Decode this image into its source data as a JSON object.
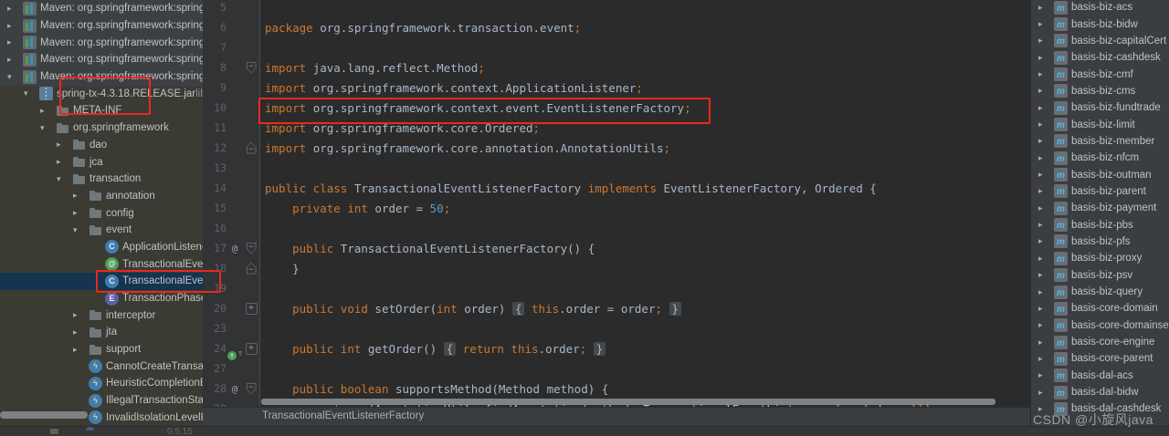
{
  "window": {
    "watermark": "CSDN @小旋风java"
  },
  "colors": {
    "annotation_red": "#E8291D",
    "tree_selection_blue": "#15344E",
    "keyword_orange": "#CC7832",
    "number_blue": "#6897BB",
    "editor_bg": "#2B2B2B",
    "panel_bg": "#3D4042",
    "panel_lower_bg": "#3B3A33"
  },
  "left_tree": {
    "rows": [
      {
        "d": 0,
        "a": ">",
        "icon": "lib",
        "label": "Maven: org.springframework:spring-"
      },
      {
        "d": 0,
        "a": ">",
        "icon": "lib",
        "label": "Maven: org.springframework:spring-"
      },
      {
        "d": 0,
        "a": ">",
        "icon": "lib",
        "label": "Maven: org.springframework:spring-"
      },
      {
        "d": 0,
        "a": ">",
        "icon": "lib",
        "label": "Maven: org.springframework:spring-"
      },
      {
        "d": 0,
        "a": "v",
        "icon": "lib",
        "label": "Maven: org.springframework:spring-"
      },
      {
        "d": 1,
        "a": "v",
        "icon": "jar",
        "label": "spring-tx-4.3.18.RELEASE.jar",
        "suffix": "library"
      },
      {
        "d": 2,
        "a": ">",
        "icon": "folder",
        "label": "META-INF"
      },
      {
        "d": 2,
        "a": "v",
        "icon": "folder",
        "label": "org.springframework"
      },
      {
        "d": 3,
        "a": ">",
        "icon": "folder",
        "label": "dao"
      },
      {
        "d": 3,
        "a": ">",
        "icon": "folder",
        "label": "jca"
      },
      {
        "d": 3,
        "a": "v",
        "icon": "folder",
        "label": "transaction"
      },
      {
        "d": 4,
        "a": ">",
        "icon": "folder",
        "label": "annotation"
      },
      {
        "d": 4,
        "a": ">",
        "icon": "folder",
        "label": "config"
      },
      {
        "d": 4,
        "a": "v",
        "icon": "folder",
        "label": "event"
      },
      {
        "d": 5,
        "a": "",
        "icon": "cls",
        "label": "ApplicationListenerMethodTransactionalAdapter"
      },
      {
        "d": 5,
        "a": "",
        "icon": "ann",
        "label": "TransactionalEventListener"
      },
      {
        "d": 5,
        "a": "",
        "icon": "cls",
        "label": "TransactionalEventListenerFactory",
        "sel": true
      },
      {
        "d": 5,
        "a": "",
        "icon": "enm",
        "label": "TransactionPhase"
      },
      {
        "d": 4,
        "a": ">",
        "icon": "folder",
        "label": "interceptor"
      },
      {
        "d": 4,
        "a": ">",
        "icon": "folder",
        "label": "jta"
      },
      {
        "d": 4,
        "a": ">",
        "icon": "folder",
        "label": "support"
      },
      {
        "d": 4,
        "a": "",
        "icon": "exc",
        "label": "CannotCreateTransactionException"
      },
      {
        "d": 4,
        "a": "",
        "icon": "exc",
        "label": "HeuristicCompletionException"
      },
      {
        "d": 4,
        "a": "",
        "icon": "exc",
        "label": "IllegalTransactionStateException"
      },
      {
        "d": 4,
        "a": "",
        "icon": "exc",
        "label": "InvalidIsolationLevelException"
      }
    ]
  },
  "right_tree": {
    "rows": [
      {
        "d": 0,
        "a": ">",
        "icon": "mod",
        "label": "basis-biz-acs"
      },
      {
        "d": 0,
        "a": ">",
        "icon": "mod",
        "label": "basis-biz-bidw"
      },
      {
        "d": 0,
        "a": ">",
        "icon": "mod",
        "label": "basis-biz-capitalCert"
      },
      {
        "d": 0,
        "a": ">",
        "icon": "mod",
        "label": "basis-biz-cashdesk"
      },
      {
        "d": 0,
        "a": ">",
        "icon": "mod",
        "label": "basis-biz-cmf"
      },
      {
        "d": 0,
        "a": ">",
        "icon": "mod",
        "label": "basis-biz-cms"
      },
      {
        "d": 0,
        "a": ">",
        "icon": "mod",
        "label": "basis-biz-fundtrade"
      },
      {
        "d": 0,
        "a": ">",
        "icon": "mod",
        "label": "basis-biz-limit"
      },
      {
        "d": 0,
        "a": ">",
        "icon": "mod",
        "label": "basis-biz-member"
      },
      {
        "d": 0,
        "a": ">",
        "icon": "mod",
        "label": "basis-biz-nfcm"
      },
      {
        "d": 0,
        "a": ">",
        "icon": "mod",
        "label": "basis-biz-outman"
      },
      {
        "d": 0,
        "a": ">",
        "icon": "mod",
        "label": "basis-biz-parent"
      },
      {
        "d": 0,
        "a": ">",
        "icon": "mod",
        "label": "basis-biz-payment"
      },
      {
        "d": 0,
        "a": ">",
        "icon": "mod",
        "label": "basis-biz-pbs"
      },
      {
        "d": 0,
        "a": ">",
        "icon": "mod",
        "label": "basis-biz-pfs"
      },
      {
        "d": 0,
        "a": ">",
        "icon": "mod",
        "label": "basis-biz-proxy"
      },
      {
        "d": 0,
        "a": ">",
        "icon": "mod",
        "label": "basis-biz-psv"
      },
      {
        "d": 0,
        "a": ">",
        "icon": "mod",
        "label": "basis-biz-query"
      },
      {
        "d": 0,
        "a": ">",
        "icon": "mod",
        "label": "basis-core-domain"
      },
      {
        "d": 0,
        "a": ">",
        "icon": "mod",
        "label": "basis-core-domainservice"
      },
      {
        "d": 0,
        "a": ">",
        "icon": "mod",
        "label": "basis-core-engine"
      },
      {
        "d": 0,
        "a": ">",
        "icon": "mod",
        "label": "basis-core-parent"
      },
      {
        "d": 0,
        "a": ">",
        "icon": "mod",
        "label": "basis-dal-acs"
      },
      {
        "d": 0,
        "a": ">",
        "icon": "mod",
        "label": "basis-dal-bidw"
      },
      {
        "d": 0,
        "a": ">",
        "icon": "mod",
        "label": "basis-dal-cashdesk"
      }
    ]
  },
  "editor": {
    "breadcrumb": "TransactionalEventListenerFactory",
    "lines": [
      {
        "num": "5",
        "mark": "",
        "fold": "",
        "segments": []
      },
      {
        "num": "6",
        "mark": "",
        "fold": "",
        "segments": [
          [
            "k",
            "package "
          ],
          [
            "p",
            "org.springframework.transaction.event"
          ],
          [
            "k",
            ";"
          ]
        ]
      },
      {
        "num": "7",
        "mark": "",
        "fold": "",
        "segments": []
      },
      {
        "num": "8",
        "mark": "",
        "fold": "down",
        "segments": [
          [
            "k",
            "import "
          ],
          [
            "p",
            "java.lang.reflect.Method"
          ],
          [
            "k",
            ";"
          ]
        ]
      },
      {
        "num": "9",
        "mark": "",
        "fold": "",
        "segments": [
          [
            "k",
            "import "
          ],
          [
            "p",
            "org.springframework.context.ApplicationListener"
          ],
          [
            "k",
            ";"
          ]
        ]
      },
      {
        "num": "10",
        "mark": "",
        "fold": "",
        "segments": [
          [
            "k",
            "import "
          ],
          [
            "p",
            "org.springframework.context.event.EventListenerFactory"
          ],
          [
            "k",
            ";"
          ]
        ]
      },
      {
        "num": "11",
        "mark": "",
        "fold": "",
        "segments": [
          [
            "k",
            "import "
          ],
          [
            "p",
            "org.springframework.core.Ordered"
          ],
          [
            "k",
            ";"
          ]
        ]
      },
      {
        "num": "12",
        "mark": "",
        "fold": "up",
        "segments": [
          [
            "k",
            "import "
          ],
          [
            "p",
            "org.springframework.core.annotation.AnnotationUtils"
          ],
          [
            "k",
            ";"
          ]
        ]
      },
      {
        "num": "13",
        "mark": "",
        "fold": "",
        "segments": []
      },
      {
        "num": "14",
        "mark": "",
        "fold": "",
        "segments": [
          [
            "k",
            "public class "
          ],
          [
            "p",
            "TransactionalEventListenerFactory "
          ],
          [
            "k",
            "implements "
          ],
          [
            "p",
            "EventListenerFactory, Ordered {"
          ]
        ]
      },
      {
        "num": "15",
        "mark": "",
        "fold": "",
        "segments": [
          [
            "p",
            "    "
          ],
          [
            "k",
            "private int "
          ],
          [
            "p",
            "order = "
          ],
          [
            "n",
            "50"
          ],
          [
            "k",
            ";"
          ]
        ]
      },
      {
        "num": "16",
        "mark": "",
        "fold": "",
        "segments": []
      },
      {
        "num": "17",
        "mark": "at",
        "fold": "down",
        "segments": [
          [
            "p",
            "    "
          ],
          [
            "k",
            "public "
          ],
          [
            "p",
            "TransactionalEventListenerFactory() {"
          ]
        ]
      },
      {
        "num": "18",
        "mark": "",
        "fold": "up",
        "segments": [
          [
            "p",
            "    }"
          ]
        ]
      },
      {
        "num": "19",
        "mark": "",
        "fold": "",
        "segments": []
      },
      {
        "num": "20",
        "mark": "",
        "fold": "plus",
        "segments": [
          [
            "p",
            "    "
          ],
          [
            "k",
            "public void "
          ],
          [
            "p",
            "setOrder("
          ],
          [
            "k",
            "int"
          ],
          [
            "p",
            " order) "
          ],
          [
            "f",
            "{"
          ],
          [
            "p",
            " "
          ],
          [
            "k",
            "this"
          ],
          [
            "p",
            ".order = order"
          ],
          [
            "k",
            ";"
          ],
          [
            "p",
            " "
          ],
          [
            "f",
            "}"
          ]
        ]
      },
      {
        "num": "23",
        "mark": "",
        "fold": "",
        "segments": []
      },
      {
        "num": "24",
        "mark": "override",
        "fold": "plus",
        "segments": [
          [
            "p",
            "    "
          ],
          [
            "k",
            "public int "
          ],
          [
            "p",
            "getOrder() "
          ],
          [
            "f",
            "{"
          ],
          [
            "p",
            " "
          ],
          [
            "k",
            "return this"
          ],
          [
            "p",
            ".order"
          ],
          [
            "k",
            ";"
          ],
          [
            "p",
            " "
          ],
          [
            "f",
            "}"
          ]
        ]
      },
      {
        "num": "27",
        "mark": "",
        "fold": "",
        "segments": []
      },
      {
        "num": "28",
        "mark": "at",
        "fold": "down",
        "segments": [
          [
            "p",
            "    "
          ],
          [
            "k",
            "public boolean "
          ],
          [
            "p",
            "supportsMethod(Method method) {"
          ]
        ]
      },
      {
        "num": "29",
        "mark": "",
        "fold": "",
        "segments": [
          [
            "p",
            "        "
          ],
          [
            "k",
            "return "
          ],
          [
            "p",
            "(AnnotationUtils.findAnnotation(method, TransactionalEventListener."
          ],
          [
            "k",
            "class"
          ],
          [
            "p",
            ") != "
          ],
          [
            "k",
            "null"
          ],
          [
            "p",
            ");"
          ]
        ]
      }
    ]
  },
  "bottom_bar": {
    "left_text": "0.5.15"
  }
}
